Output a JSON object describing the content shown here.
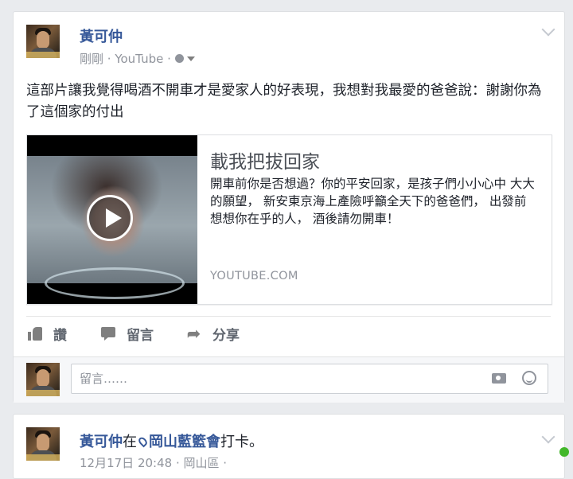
{
  "post": {
    "author": "黃可仲",
    "time": "剛剛",
    "source_sep": " · ",
    "source": "YouTube",
    "privacy_icon": "globe-icon",
    "text": "這部片讓我覺得喝酒不開車才是愛家人的好表現，我想對我最愛的爸爸說：謝謝你為了這個家的付出",
    "link": {
      "title": "載我把拔回家",
      "description": "開車前你是否想過？你的平安回家，是孩子們小小心中 大大的願望， 新安東京海上產險呼籲全天下的爸爸們， 出發前想想你在乎的人， 酒後請勿開車！",
      "domain": "YOUTUBE.COM"
    },
    "actions": {
      "like": "讚",
      "comment": "留言",
      "share": "分享"
    },
    "comment_placeholder": "留言……"
  },
  "next_post": {
    "author": "黃可仲",
    "at": "在",
    "place": "岡山藍籃會",
    "checkin": "打卡。",
    "meta_partial": "12月17日 20:48 · 岡山區 · "
  },
  "colors": {
    "link_blue": "#365899",
    "muted": "#90949c",
    "online": "#42b72a"
  }
}
